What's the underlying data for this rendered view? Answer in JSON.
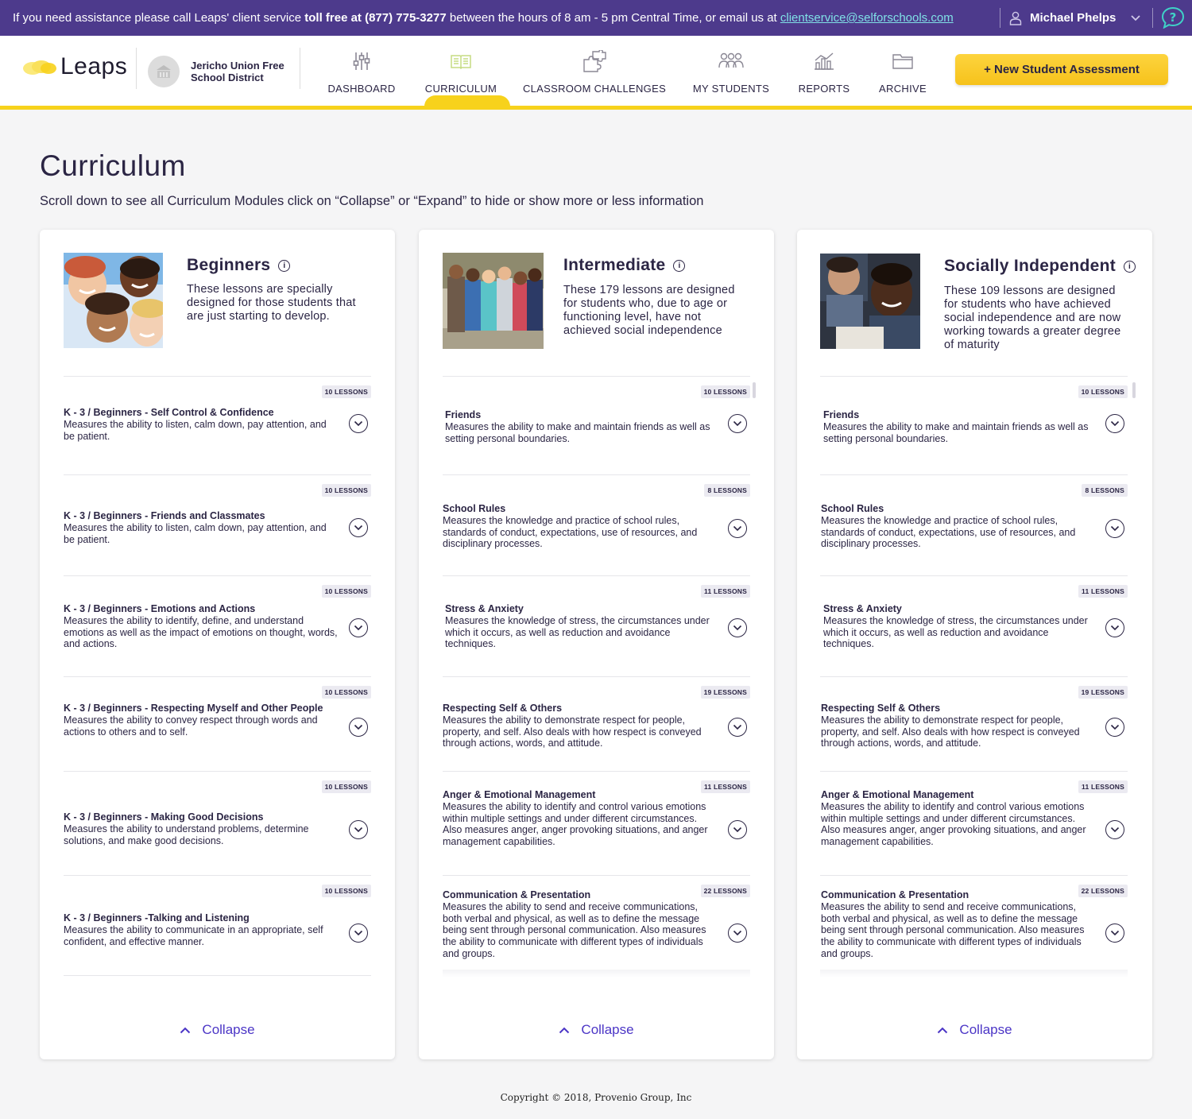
{
  "banner": {
    "text_before": "If you need assistance please call Leaps' client service ",
    "phone": "toll free at (877) 775-3277",
    "text_after": " between the hours of 8 am - 5 pm Central Time, or email us at ",
    "email": "clientservice@selforschools.com",
    "user_name": "Michael Phelps"
  },
  "header": {
    "logo": "Leaps",
    "district": "Jericho Union Free School District",
    "nav": [
      {
        "label": "DASHBOARD",
        "icon": "sliders-icon"
      },
      {
        "label": "CURRICULUM",
        "icon": "open-book-icon",
        "active": true
      },
      {
        "label": "CLASSROOM CHALLENGES",
        "icon": "puzzle-icon"
      },
      {
        "label": "MY STUDENTS",
        "icon": "students-icon"
      },
      {
        "label": "REPORTS",
        "icon": "chart-icon"
      },
      {
        "label": "ARCHIVE",
        "icon": "folder-icon"
      }
    ],
    "new_button": "+ New Student Assessment",
    "accent": "#f7d21c",
    "brand": "#4d3a8c"
  },
  "page": {
    "title": "Curriculum",
    "subtitle": "Scroll down to see all Curriculum Modules click on “Collapse” or “Expand” to hide or show more or less information"
  },
  "cards": [
    {
      "title": "Beginners",
      "description": "These lessons are specially designed for those students that are just starting to develop.",
      "collapse_label": "Collapse",
      "modules": [
        {
          "badge": "10 LESSONS",
          "title": "K - 3 / Beginners - Self Control & Confidence",
          "desc": "Measures the ability to listen, calm down, pay attention, and be patient."
        },
        {
          "badge": "10 LESSONS",
          "title": "K - 3 / Beginners  - Friends and Classmates",
          "desc": "Measures the ability to listen, calm down, pay attention, and be patient."
        },
        {
          "badge": "10 LESSONS",
          "title": "K - 3 / Beginners - Emotions and Actions",
          "desc": "Measures the ability to identify, define, and understand emotions as well as the impact of emotions on thought, words, and actions."
        },
        {
          "badge": "10 LESSONS",
          "title": "K - 3 / Beginners - Respecting Myself and Other People",
          "desc": "Measures the ability to convey respect through words and actions to others and to self."
        },
        {
          "badge": "10 LESSONS",
          "title": "K - 3 / Beginners - Making Good Decisions",
          "desc": "Measures the ability to understand problems, determine solutions, and make good decisions."
        },
        {
          "badge": "10 LESSONS",
          "title": "K - 3 / Beginners -Talking and Listening",
          "desc": "Measures the ability to communicate in an appropriate, self confident, and effective manner."
        }
      ]
    },
    {
      "title": "Intermediate",
      "description": "These 179 lessons are designed for students who, due to age or functioning level, have not achieved social independence",
      "collapse_label": "Collapse",
      "modules": [
        {
          "badge": "10 LESSONS",
          "title": "Friends",
          "desc": "Measures the ability to make and maintain friends as well as setting personal boundaries."
        },
        {
          "badge": "8 LESSONS",
          "title": "School Rules",
          "desc": "Measures the knowledge and practice of school rules, standards of conduct, expectations, use of resources, and disciplinary processes."
        },
        {
          "badge": "11 LESSONS",
          "title": "Stress & Anxiety",
          "desc": "Measures the knowledge of stress, the circumstances under which it occurs, as well as reduction and avoidance techniques."
        },
        {
          "badge": "19 LESSONS",
          "title": "Respecting Self & Others",
          "desc": "Measures the ability to demonstrate respect for people, property, and self.  Also deals with how respect is conveyed through actions, words, and attitude."
        },
        {
          "badge": "11 LESSONS",
          "title": "Anger & Emotional Management",
          "desc": "Measures the ability to identify and control various emotions within multiple settings and under different circumstances.  Also measures anger, anger provoking situations, and anger management capabilities."
        },
        {
          "badge": "22 LESSONS",
          "title": "Communication & Presentation",
          "desc": "Measures the ability to send and receive communications, both verbal and physical, as well as to define the message being sent through personal communication. Also measures the ability to communicate with different types of individuals and groups."
        }
      ]
    },
    {
      "title": "Socially Independent",
      "description": "These 109 lessons are designed for students who have achieved social independence and are now working towards a greater degree of maturity",
      "collapse_label": "Collapse",
      "modules": [
        {
          "badge": "10 LESSONS",
          "title": "Friends",
          "desc": "Measures the ability to make and maintain friends as well as setting personal boundaries."
        },
        {
          "badge": "8 LESSONS",
          "title": "School Rules",
          "desc": "Measures the knowledge and practice of school rules, standards of conduct, expectations, use of resources, and disciplinary processes."
        },
        {
          "badge": "11 LESSONS",
          "title": "Stress & Anxiety",
          "desc": "Measures the knowledge of stress, the circumstances under which it occurs, as well as reduction and avoidance techniques."
        },
        {
          "badge": "19 LESSONS",
          "title": "Respecting Self & Others",
          "desc": "Measures the ability to demonstrate respect for people, property, and self.  Also deals with how respect is conveyed through actions, words, and attitude."
        },
        {
          "badge": "11 LESSONS",
          "title": "Anger & Emotional Management",
          "desc": "Measures the ability to identify and control various emotions within multiple settings and under different circumstances.  Also measures anger, anger provoking situations, and anger management capabilities."
        },
        {
          "badge": "22 LESSONS",
          "title": "Communication & Presentation",
          "desc": "Measures the ability to send and receive communications, both verbal and physical, as well as to define the message being sent through personal communication. Also measures the ability to communicate with different types of individuals and groups."
        }
      ]
    }
  ],
  "footer": "Copyright © 2018, Provenio Group, Inc"
}
